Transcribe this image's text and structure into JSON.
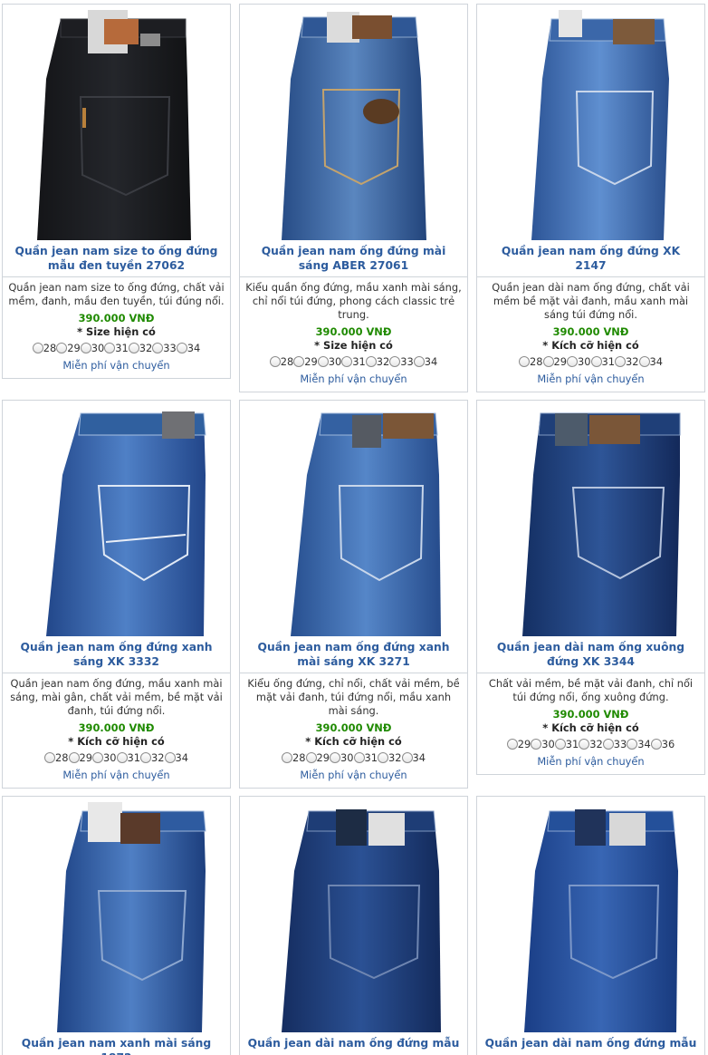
{
  "colors": {
    "title": "#2d5c9e",
    "price": "#1f8a00",
    "border": "#cfd4da",
    "denim_black": "#1b1c1f",
    "denim_mid": "#355f9a",
    "denim_light": "#4a7bc2",
    "denim_dark": "#1f3f78"
  },
  "products": [
    {
      "title": "Quần jean nam size to ống đứng mẫu đen tuyền 27062",
      "description": "Quần jean nam size to ống đứng, chất vải mềm, đanh, mầu đen tuyền, túi đúng nổi.",
      "price": "390.000 VNĐ",
      "sizes_label": "* Size hiện có",
      "sizes": [
        "28",
        "29",
        "30",
        "31",
        "32",
        "33",
        "34"
      ],
      "shipping": "Miễn phí vận chuyển",
      "image_icon": "jeans-black-photo"
    },
    {
      "title": "Quần jean nam ống đứng mài sáng ABER 27061",
      "description": "Kiểu quần ống đứng, mầu xanh mài sáng, chỉ nổi túi đứng, phong cách classic trẻ trung.",
      "price": "390.000 VNĐ",
      "sizes_label": "* Size hiện có",
      "sizes": [
        "28",
        "29",
        "30",
        "31",
        "32",
        "33",
        "34"
      ],
      "shipping": "Miễn phí vận chuyển",
      "image_icon": "jeans-blue-photo"
    },
    {
      "title": "Quần jean nam ống đứng XK 2147",
      "description": "Quần jean dài nam ống đứng, chất vải mềm bề mặt vải đanh, mầu xanh mài sáng túi đứng nổi.",
      "price": "390.000 VNĐ",
      "sizes_label": "* Kích cỡ hiện có",
      "sizes": [
        "28",
        "29",
        "30",
        "31",
        "32",
        "34"
      ],
      "shipping": "Miễn phí vận chuyển",
      "image_icon": "jeans-light-blue-photo"
    },
    {
      "title": "Quần jean nam ống đứng xanh sáng XK 3332",
      "description": "Quần jean nam ống đứng, mầu xanh mài sáng, mài gân, chất vải mềm, bề mặt vải đanh, túi đứng nổi.",
      "price": "390.000 VNĐ",
      "sizes_label": "* Kích cỡ hiện có",
      "sizes": [
        "28",
        "29",
        "30",
        "31",
        "32",
        "34"
      ],
      "shipping": "Miễn phí vận chuyển",
      "image_icon": "jeans-blue-photo"
    },
    {
      "title": "Quần jean nam ống đứng xanh mài sáng XK 3271",
      "description": "Kiểu ống đứng, chỉ nổi, chất vải mềm, bề mặt vải đanh, túi đứng nổi, mầu xanh mài sáng.",
      "price": "390.000 VNĐ",
      "sizes_label": "* Kích cỡ hiện có",
      "sizes": [
        "28",
        "29",
        "30",
        "31",
        "32",
        "34"
      ],
      "shipping": "Miễn phí vận chuyển",
      "image_icon": "jeans-blue-photo"
    },
    {
      "title": "Quần jean dài nam ống xuông đứng XK 3344",
      "description": "Chất vải mềm, bề mặt vải đanh, chỉ nổi túi đứng nổi, ống xuông đứng.",
      "price": "390.000 VNĐ",
      "sizes_label": "* Kích cỡ hiện có",
      "sizes": [
        "29",
        "30",
        "31",
        "32",
        "33",
        "34",
        "36"
      ],
      "shipping": "Miễn phí vận chuyển",
      "image_icon": "jeans-dark-blue-photo"
    },
    {
      "title": "Quần jean nam xanh mài sáng 1872",
      "image_icon": "jeans-blue-photo"
    },
    {
      "title": "Quần jean dài nam ống đứng mẫu",
      "image_icon": "jeans-dark-blue-photo"
    },
    {
      "title": "Quần jean dài nam ống đứng mẫu",
      "image_icon": "jeans-dark-blue-photo"
    }
  ]
}
